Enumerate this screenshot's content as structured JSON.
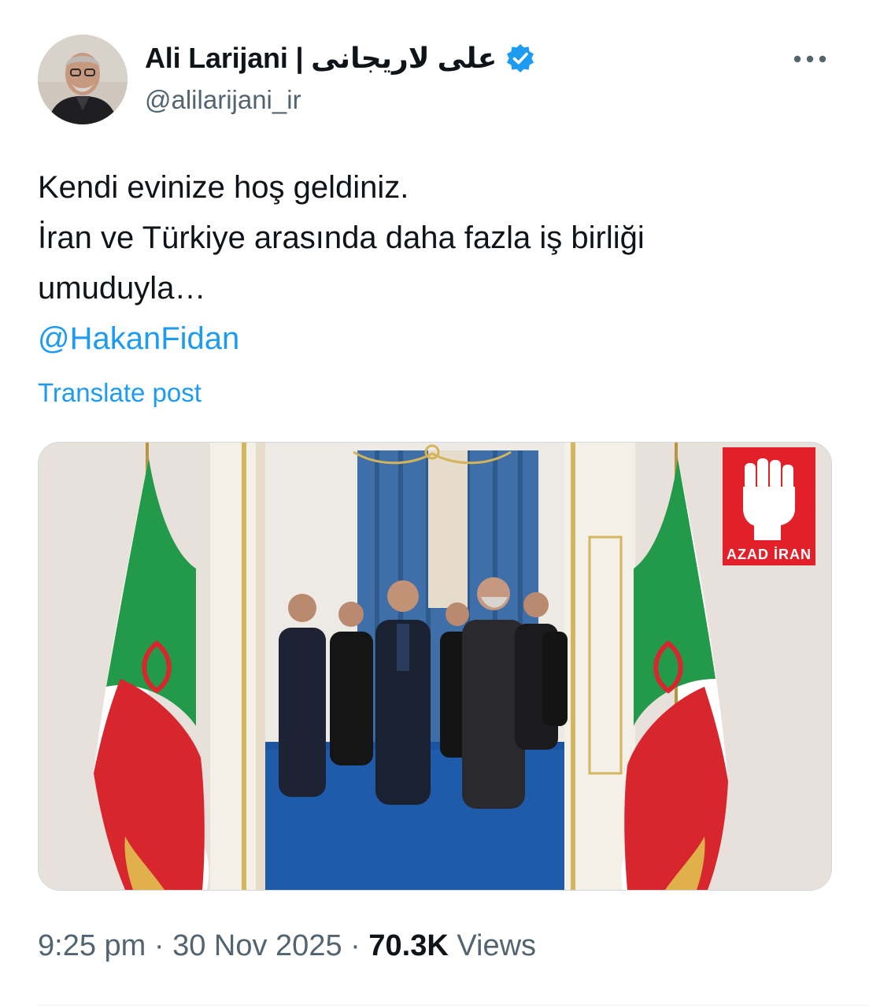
{
  "author": {
    "display_name": "Ali Larijani | علی لاریجانی",
    "handle": "@alilarijani_ir",
    "avatar_icon": "portrait-avatar",
    "verified_icon": "verified-badge-icon",
    "verified_color": "#1d9bf0"
  },
  "menu": {
    "more_icon": "more-dots-icon"
  },
  "post": {
    "lines": [
      "Kendi evinize hoş geldiniz.",
      "İran ve Türkiye arasında daha fazla iş birliği",
      "umuduyla…"
    ],
    "mention": "@HakanFidan",
    "translate_label": "Translate post"
  },
  "media": {
    "watermark_text": "AZAD İRAN",
    "watermark_icon": "raised-fist-icon",
    "watermark_color": "#e2202a"
  },
  "meta": {
    "time": "9:25 pm",
    "separator": "·",
    "date": "30 Nov 2025",
    "views_count": "70.3K",
    "views_label": "Views"
  },
  "colors": {
    "accent": "#1d9bf0",
    "text": "#0f1419",
    "secondary": "#536471"
  }
}
